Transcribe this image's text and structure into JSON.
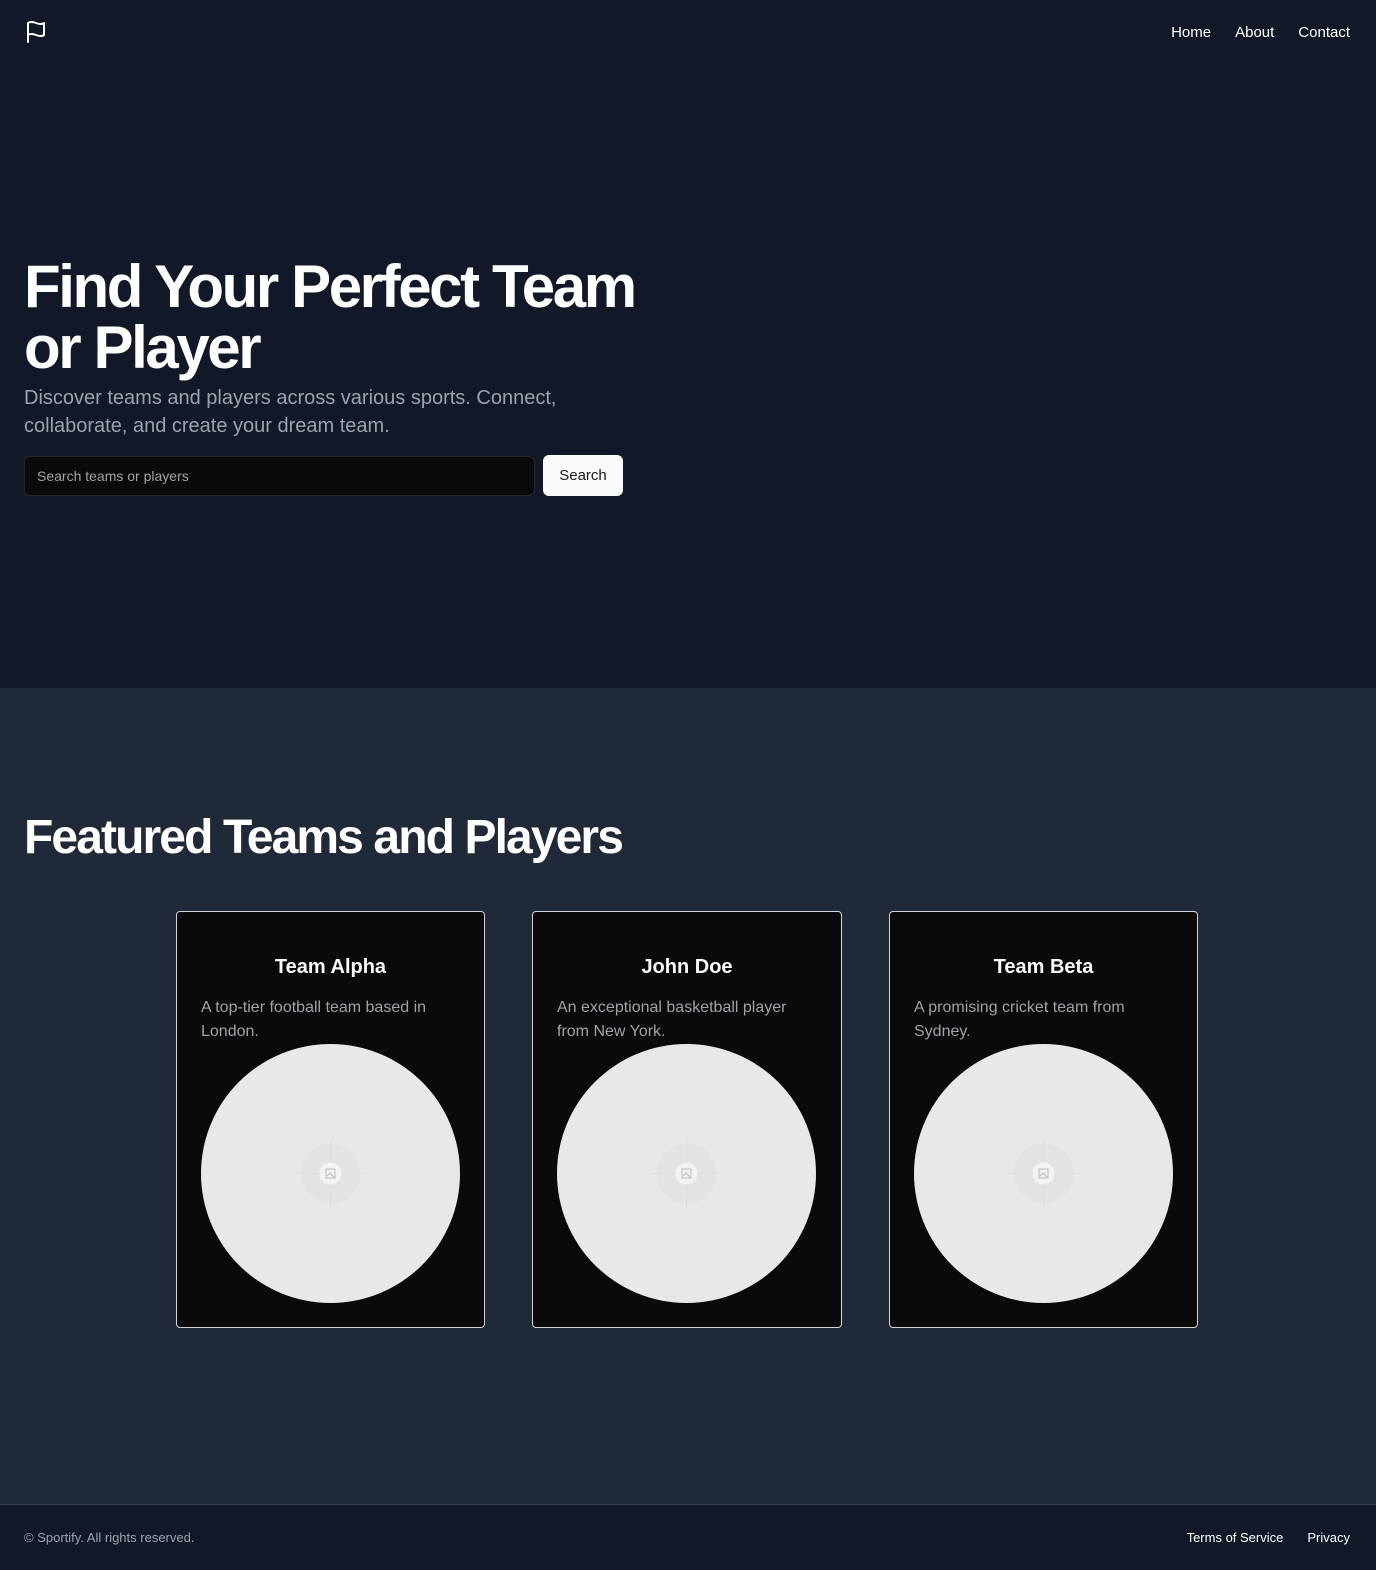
{
  "header": {
    "logo_icon": "flag-icon",
    "nav": [
      {
        "label": "Home"
      },
      {
        "label": "About"
      },
      {
        "label": "Contact"
      }
    ]
  },
  "hero": {
    "title": "Find Your Perfect Team or Player",
    "subtitle": "Discover teams and players across various sports. Connect, collaborate, and create your dream team.",
    "search": {
      "placeholder": "Search teams or players",
      "value": "",
      "button_label": "Search"
    }
  },
  "featured": {
    "title": "Featured Teams and Players",
    "cards": [
      {
        "title": "Team Alpha",
        "description": "A top-tier football team based in London.",
        "image_icon": "image-placeholder-icon"
      },
      {
        "title": "John Doe",
        "description": "An exceptional basketball player from New York.",
        "image_icon": "image-placeholder-icon"
      },
      {
        "title": "Team Beta",
        "description": "A promising cricket team from Sydney.",
        "image_icon": "image-placeholder-icon"
      }
    ]
  },
  "footer": {
    "copyright": "© Sportify. All rights reserved.",
    "links": [
      {
        "label": "Terms of Service"
      },
      {
        "label": "Privacy"
      }
    ]
  },
  "colors": {
    "hero_bg": "#111827",
    "section_bg": "#1f2937",
    "card_bg": "#0a0a0b",
    "muted_text": "#9ca3af",
    "button_bg": "#fafafa"
  }
}
